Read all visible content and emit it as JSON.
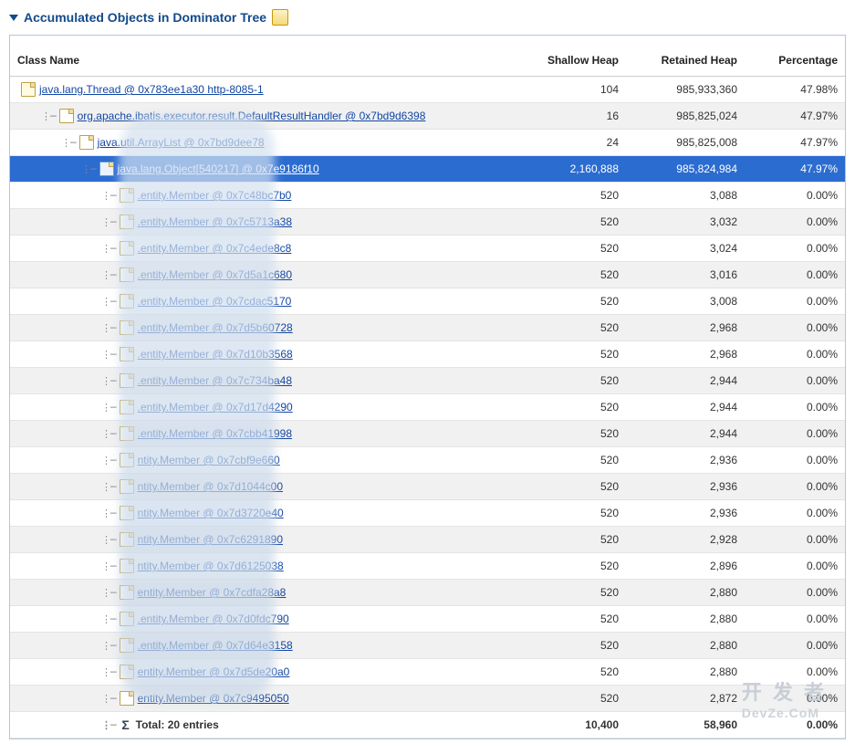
{
  "header": {
    "title": "Accumulated Objects in Dominator Tree"
  },
  "columns": {
    "c1": "Class Name",
    "c2": "Shallow Heap",
    "c3": "Retained Heap",
    "c4": "Percentage"
  },
  "rows": [
    {
      "indent": 0,
      "icon": "thread",
      "label": "java.lang.Thread @ 0x783ee1a30 http-8085-1",
      "shallow": "104",
      "retained": "985,933,360",
      "pct": "47.98%",
      "selected": false
    },
    {
      "indent": 1,
      "icon": "file",
      "label": "org.apache.ibatis.executor.result.DefaultResultHandler @ 0x7bd9d6398",
      "shallow": "16",
      "retained": "985,825,024",
      "pct": "47.97%",
      "selected": false
    },
    {
      "indent": 2,
      "icon": "file",
      "label": "java.util.ArrayList @ 0x7bd9dee78",
      "shallow": "24",
      "retained": "985,825,008",
      "pct": "47.97%",
      "selected": false
    },
    {
      "indent": 3,
      "icon": "arr",
      "label": "java.lang.Object[540217] @ 0x7e9186f10",
      "shallow": "2,160,888",
      "retained": "985,824,984",
      "pct": "47.97%",
      "selected": true
    },
    {
      "indent": 4,
      "icon": "file",
      "label": ".entity.Member @ 0x7c48bc7b0",
      "shallow": "520",
      "retained": "3,088",
      "pct": "0.00%"
    },
    {
      "indent": 4,
      "icon": "file",
      "label": ".entity.Member @ 0x7c5713a38",
      "shallow": "520",
      "retained": "3,032",
      "pct": "0.00%"
    },
    {
      "indent": 4,
      "icon": "file",
      "label": ".entity.Member @ 0x7c4ede8c8",
      "shallow": "520",
      "retained": "3,024",
      "pct": "0.00%"
    },
    {
      "indent": 4,
      "icon": "file",
      "label": ".entity.Member @ 0x7d5a1c680",
      "shallow": "520",
      "retained": "3,016",
      "pct": "0.00%"
    },
    {
      "indent": 4,
      "icon": "file",
      "label": ".entity.Member @ 0x7cdac5170",
      "shallow": "520",
      "retained": "3,008",
      "pct": "0.00%"
    },
    {
      "indent": 4,
      "icon": "file",
      "label": ".entity.Member @ 0x7d5b60728",
      "shallow": "520",
      "retained": "2,968",
      "pct": "0.00%"
    },
    {
      "indent": 4,
      "icon": "file",
      "label": ".entity.Member @ 0x7d10b3568",
      "shallow": "520",
      "retained": "2,968",
      "pct": "0.00%"
    },
    {
      "indent": 4,
      "icon": "file",
      "label": ".entity.Member @ 0x7c734ba48",
      "shallow": "520",
      "retained": "2,944",
      "pct": "0.00%"
    },
    {
      "indent": 4,
      "icon": "file",
      "label": ".entity.Member @ 0x7d17d4290",
      "shallow": "520",
      "retained": "2,944",
      "pct": "0.00%"
    },
    {
      "indent": 4,
      "icon": "file",
      "label": ".entity.Member @ 0x7cbb41998",
      "shallow": "520",
      "retained": "2,944",
      "pct": "0.00%"
    },
    {
      "indent": 4,
      "icon": "file",
      "label": "ntity.Member @ 0x7cbf9e660",
      "shallow": "520",
      "retained": "2,936",
      "pct": "0.00%"
    },
    {
      "indent": 4,
      "icon": "file",
      "label": "ntity.Member @ 0x7d1044c00",
      "shallow": "520",
      "retained": "2,936",
      "pct": "0.00%"
    },
    {
      "indent": 4,
      "icon": "file",
      "label": "ntity.Member @ 0x7d3720e40",
      "shallow": "520",
      "retained": "2,936",
      "pct": "0.00%"
    },
    {
      "indent": 4,
      "icon": "file",
      "label": "ntity.Member @ 0x7c6291890",
      "shallow": "520",
      "retained": "2,928",
      "pct": "0.00%"
    },
    {
      "indent": 4,
      "icon": "file",
      "label": "ntity.Member @ 0x7d6125038",
      "shallow": "520",
      "retained": "2,896",
      "pct": "0.00%"
    },
    {
      "indent": 4,
      "icon": "file",
      "label": "entity.Member @ 0x7cdfa28a8",
      "shallow": "520",
      "retained": "2,880",
      "pct": "0.00%"
    },
    {
      "indent": 4,
      "icon": "file",
      "label": ".entity.Member @ 0x7d0fdc790",
      "shallow": "520",
      "retained": "2,880",
      "pct": "0.00%"
    },
    {
      "indent": 4,
      "icon": "file",
      "label": ".entity.Member @ 0x7d64e3158",
      "shallow": "520",
      "retained": "2,880",
      "pct": "0.00%"
    },
    {
      "indent": 4,
      "icon": "file",
      "label": "entity.Member @ 0x7d5de20a0",
      "shallow": "520",
      "retained": "2,880",
      "pct": "0.00%"
    },
    {
      "indent": 4,
      "icon": "file",
      "label": "entity.Member @ 0x7c9495050",
      "shallow": "520",
      "retained": "2,872",
      "pct": "0.00%"
    }
  ],
  "total": {
    "label": "Total: 20 entries",
    "shallow": "10,400",
    "retained": "58,960",
    "pct": "0.00%",
    "indent": 4
  },
  "watermark": {
    "line1": "开 发 者",
    "line2": "DevZe.CoM"
  }
}
